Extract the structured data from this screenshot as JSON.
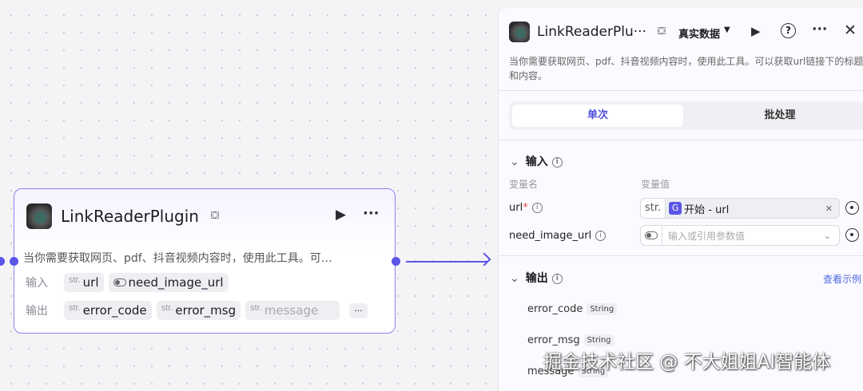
{
  "node": {
    "title": "LinkReaderPlugin",
    "description": "当你需要获取网页、pdf、抖音视频内容时，使用此工具。可…",
    "input_label": "输入",
    "output_label": "输出",
    "type_tag": "str.",
    "inputs": [
      "url",
      "need_image_url"
    ],
    "outputs": [
      "error_code",
      "error_msg",
      "message"
    ],
    "more": "···"
  },
  "panel": {
    "title": "LinkReaderPlu···",
    "data_mode": "真实数据",
    "description": "当你需要获取网页、pdf、抖音视频内容时，使用此工具。可以获取url链接下的标题和内容。",
    "tabs": [
      {
        "label": "单次",
        "active": true
      },
      {
        "label": "批处理",
        "active": false
      }
    ],
    "input_section": "输入",
    "col_name": "变量名",
    "col_value": "变量值",
    "params": [
      {
        "name": "url",
        "required": "*",
        "type": "str.",
        "value": "开始 - url"
      },
      {
        "name": "need_image_url",
        "placeholder": "输入或引用参数值"
      }
    ],
    "output_section": "输出",
    "view_example": "查看示例",
    "outputs": [
      {
        "name": "error_code",
        "type": "String"
      },
      {
        "name": "error_msg",
        "type": "String"
      },
      {
        "name": "message",
        "type": "String"
      }
    ]
  },
  "watermark": "掘金技术社区 @ 不大姐姐AI智能体",
  "colors": {
    "accent": "#5a55e6",
    "link": "#4d6bdf"
  }
}
